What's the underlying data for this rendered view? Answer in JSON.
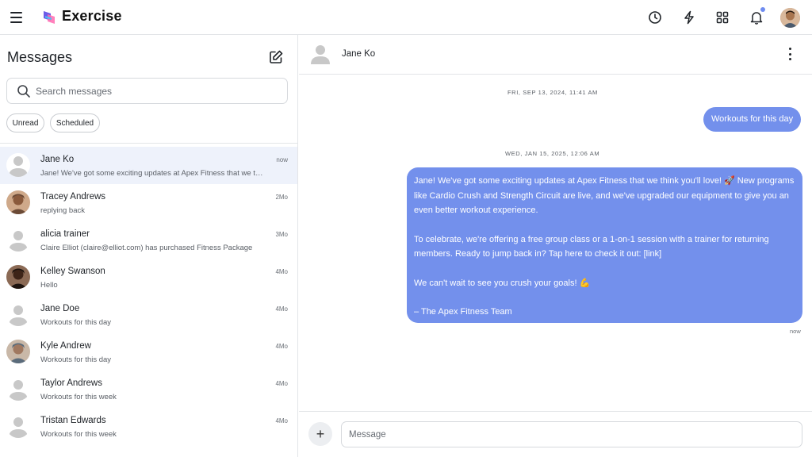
{
  "app": {
    "title": "Exercise",
    "accent_color": "#7390ec",
    "icons": [
      "menu-icon",
      "clock-icon",
      "lightning-icon",
      "grid-icon",
      "bell-icon"
    ]
  },
  "sidebar": {
    "title": "Messages",
    "compose_icon": "edit-icon",
    "search": {
      "placeholder": "Search messages"
    },
    "filters": [
      "Unread",
      "Scheduled"
    ],
    "conversations": [
      {
        "name": "Jane Ko",
        "preview": "Jane! We've got some exciting updates at Apex Fitness that we think you'll love! 🚀 New programs...",
        "time": "now",
        "active": true,
        "avatar": "default"
      },
      {
        "name": "Tracey Andrews",
        "preview": "replying back",
        "time": "2Mo",
        "active": false,
        "avatar": "photo"
      },
      {
        "name": "alicia trainer",
        "preview": "Claire Elliot (claire@elliot.com) has purchased Fitness Package",
        "time": "3Mo",
        "active": false,
        "avatar": "default"
      },
      {
        "name": "Kelley Swanson",
        "preview": "Hello",
        "time": "4Mo",
        "active": false,
        "avatar": "photo"
      },
      {
        "name": "Jane Doe",
        "preview": "Workouts for this day",
        "time": "4Mo",
        "active": false,
        "avatar": "default"
      },
      {
        "name": "Kyle Andrew",
        "preview": "Workouts for this day",
        "time": "4Mo",
        "active": false,
        "avatar": "photo"
      },
      {
        "name": "Taylor Andrews",
        "preview": "Workouts for this week",
        "time": "4Mo",
        "active": false,
        "avatar": "default"
      },
      {
        "name": "Tristan Edwards",
        "preview": "Workouts for this week",
        "time": "4Mo",
        "active": false,
        "avatar": "default"
      }
    ]
  },
  "chat": {
    "contact_name": "Jane Ko",
    "date_1": "FRI, SEP 13, 2024, 11:41 AM",
    "message_1": "Workouts for this day",
    "date_2": "WED, JAN 15, 2025, 12:06 AM",
    "message_2": {
      "p1": "Jane! We've got some exciting updates at Apex Fitness that we think you'll love! 🚀 New programs like Cardio Crush and Strength Circuit are live, and we've upgraded our equipment to give you an even better workout experience.",
      "p2": "To celebrate, we're offering a free group class or a 1-on-1 session with a trainer for returning members. Ready to jump back in? Tap here to check it out: [link]",
      "p3": "We can't wait to see you crush your goals! 💪",
      "p4": "– The Apex Fitness Team"
    },
    "message_2_time": "now",
    "composer": {
      "placeholder": "Message",
      "attach_label": "+"
    }
  }
}
